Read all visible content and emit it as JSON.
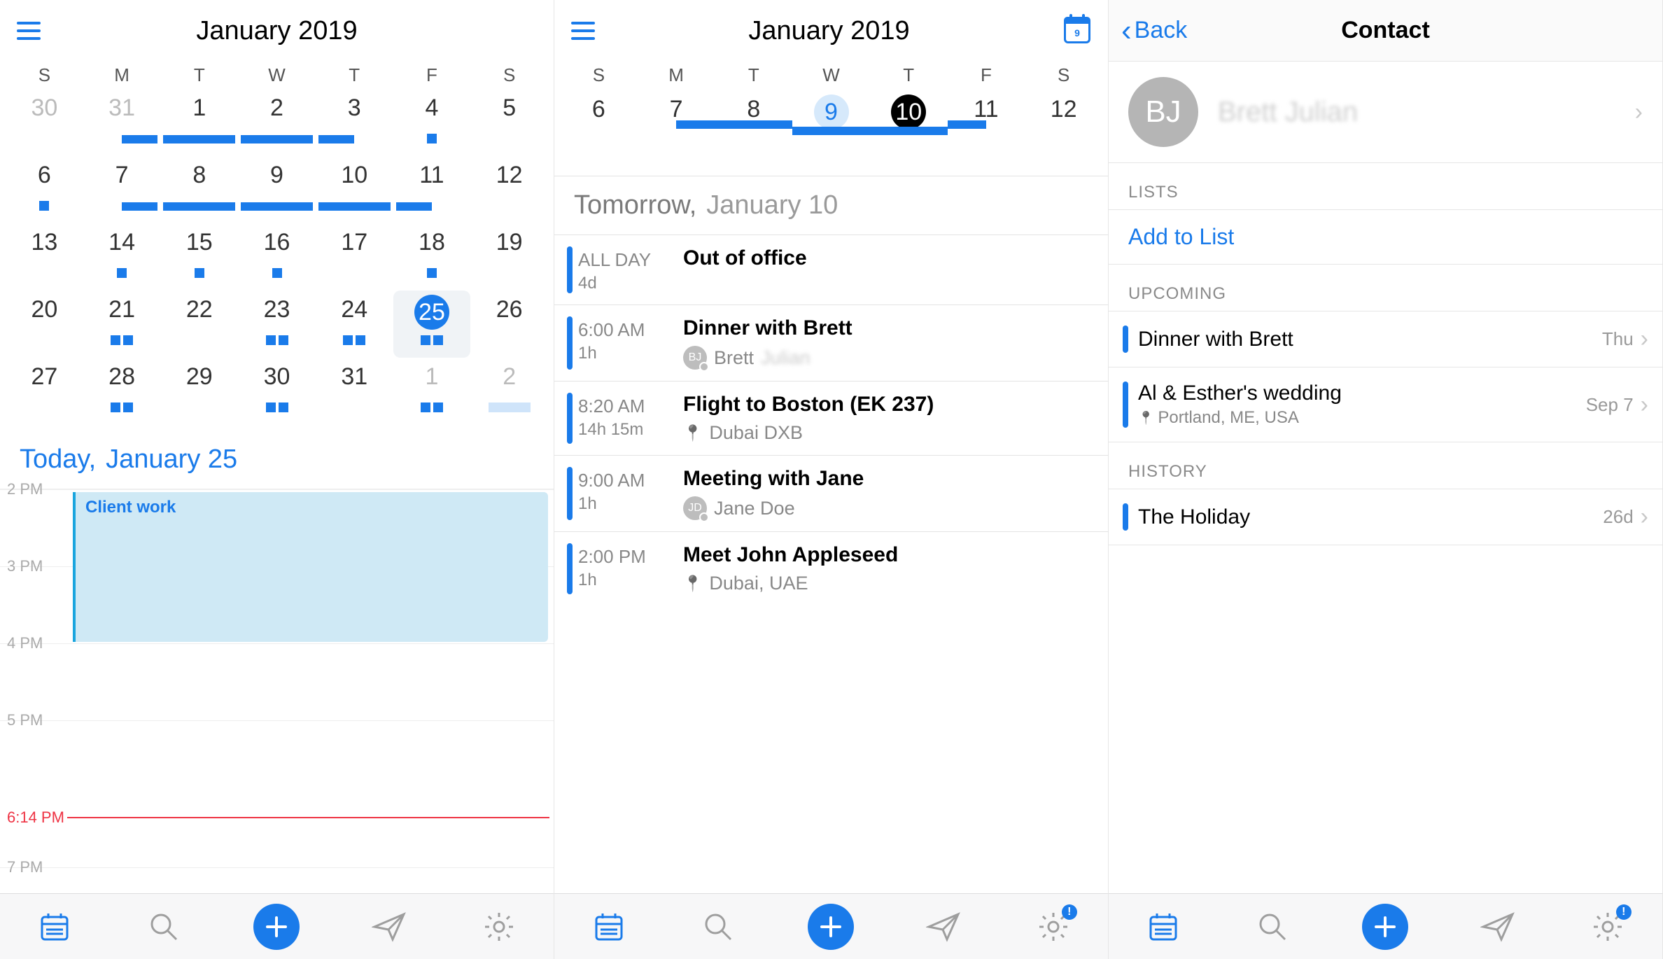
{
  "pane1": {
    "title": "January 2019",
    "weekdays": [
      "S",
      "M",
      "T",
      "W",
      "T",
      "F",
      "S"
    ],
    "monthGrid": [
      [
        {
          "n": "30",
          "dim": true,
          "m": []
        },
        {
          "n": "31",
          "dim": true,
          "m": [
            "bar-r"
          ]
        },
        {
          "n": "1",
          "m": [
            "bar"
          ]
        },
        {
          "n": "2",
          "m": [
            "bar"
          ]
        },
        {
          "n": "3",
          "m": [
            "bar-l"
          ]
        },
        {
          "n": "4",
          "m": [
            "sq"
          ]
        },
        {
          "n": "5",
          "m": []
        }
      ],
      [
        {
          "n": "6",
          "m": [
            "sq"
          ]
        },
        {
          "n": "7",
          "m": [
            "bar-r"
          ]
        },
        {
          "n": "8",
          "m": [
            "bar"
          ]
        },
        {
          "n": "9",
          "m": [
            "bar"
          ]
        },
        {
          "n": "10",
          "m": [
            "bar"
          ]
        },
        {
          "n": "11",
          "m": [
            "bar-l"
          ]
        },
        {
          "n": "12",
          "m": []
        }
      ],
      [
        {
          "n": "13",
          "m": []
        },
        {
          "n": "14",
          "m": [
            "sq"
          ]
        },
        {
          "n": "15",
          "m": [
            "sq"
          ]
        },
        {
          "n": "16",
          "m": [
            "sq"
          ]
        },
        {
          "n": "17",
          "m": []
        },
        {
          "n": "18",
          "m": [
            "sq"
          ]
        },
        {
          "n": "19",
          "m": []
        }
      ],
      [
        {
          "n": "20",
          "m": []
        },
        {
          "n": "21",
          "m": [
            "sq",
            "sq"
          ]
        },
        {
          "n": "22",
          "m": []
        },
        {
          "n": "23",
          "m": [
            "sq",
            "sq"
          ]
        },
        {
          "n": "24",
          "m": [
            "sq",
            "sq"
          ]
        },
        {
          "n": "25",
          "sel": true,
          "m": [
            "sq",
            "sq"
          ]
        },
        {
          "n": "26",
          "m": []
        }
      ],
      [
        {
          "n": "27",
          "m": []
        },
        {
          "n": "28",
          "m": [
            "sq",
            "sq"
          ]
        },
        {
          "n": "29",
          "m": []
        },
        {
          "n": "30",
          "m": [
            "sq",
            "sq"
          ]
        },
        {
          "n": "31",
          "m": []
        },
        {
          "n": "1",
          "dim": true,
          "m": [
            "sq",
            "sq"
          ]
        },
        {
          "n": "2",
          "dim": true,
          "m": [
            "sqlight"
          ]
        }
      ]
    ],
    "todayHdr": {
      "d1": "Today,",
      "d2": "January 25"
    },
    "hours": [
      "2 PM",
      "3 PM",
      "4 PM",
      "5 PM",
      "7 PM"
    ],
    "nowLabel": "6:14 PM",
    "block": {
      "title": "Client work"
    }
  },
  "pane2": {
    "title": "January 2019",
    "calBadge": "9",
    "weekdays": [
      "S",
      "M",
      "T",
      "W",
      "T",
      "F",
      "S"
    ],
    "strip": [
      {
        "n": "6"
      },
      {
        "n": "7",
        "bar": "start"
      },
      {
        "n": "8",
        "bar": "full"
      },
      {
        "n": "9",
        "ring": true,
        "bar": "full"
      },
      {
        "n": "10",
        "selBlack": true,
        "bar": "full"
      },
      {
        "n": "11",
        "bar": "end"
      },
      {
        "n": "12"
      }
    ],
    "dayHdr": {
      "d1": "Tomorrow,",
      "d2": "January 10"
    },
    "events": [
      {
        "time": "ALL DAY",
        "dur": "4d",
        "title": "Out of office"
      },
      {
        "time": "6:00 AM",
        "dur": "1h",
        "title": "Dinner with Brett",
        "avatar": "BJ",
        "person": "Brett",
        "personBlur": "Julian"
      },
      {
        "time": "8:20 AM",
        "dur": "14h 15m",
        "title": "Flight to Boston (EK 237)",
        "loc": "Dubai DXB"
      },
      {
        "time": "9:00 AM",
        "dur": "1h",
        "title": "Meeting with Jane",
        "avatar": "JD",
        "person": "Jane Doe"
      },
      {
        "time": "2:00 PM",
        "dur": "1h",
        "title": "Meet John Appleseed",
        "loc": "Dubai, UAE"
      }
    ]
  },
  "pane3": {
    "back": "Back",
    "title": "Contact",
    "avatar": "BJ",
    "name": "Brett Julian",
    "sections": {
      "lists": "LISTS",
      "addToList": "Add to List",
      "upcoming": "UPCOMING",
      "history": "HISTORY"
    },
    "upcoming": [
      {
        "title": "Dinner with Brett",
        "meta": "Thu"
      },
      {
        "title": "Al & Esther's wedding",
        "loc": "Portland, ME, USA",
        "meta": "Sep 7"
      }
    ],
    "history": [
      {
        "title": "The Holiday",
        "meta": "26d"
      }
    ]
  },
  "tabbar": {
    "settingsBadge": "!"
  }
}
